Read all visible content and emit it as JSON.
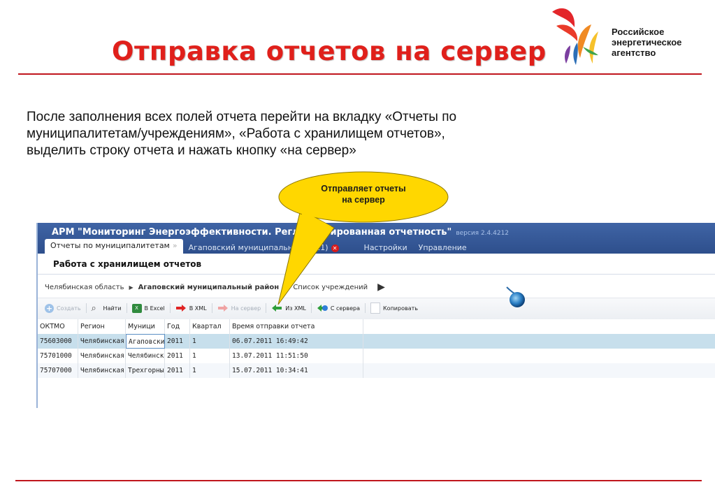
{
  "slide": {
    "title": "Отправка отчетов на сервер",
    "logo_lines": [
      "Российское",
      "энергетическое",
      "агентство"
    ],
    "intro_lines": [
      "После заполнения всех полей отчета перейти на вкладку «Отчеты по",
      "муниципалитетам/учреждениям», «Работа с хранилищем отчетов»,",
      "выделить строку отчета и нажать кнопку «на сервер»"
    ],
    "callout_lines": [
      "Отправляет отчеты",
      "на сервер"
    ]
  },
  "app": {
    "title": "АРМ \"Мониторинг Энергоэффективности. Регламентированная отчетность\"",
    "version": "версия 2.4.4212",
    "tabs": {
      "reports": "Отчеты по муниципалитетам",
      "municipality": "Агаповский муниципальн... (2011)",
      "settings": "Настройки",
      "management": "Управление"
    },
    "section_title": "Работа с хранилищем отчетов",
    "breadcrumb": {
      "region": "Челябинская область",
      "district": "Агаповский муниципальный район",
      "list": "Список учреждений"
    },
    "toolbar": {
      "create": "Создать",
      "find": "Найти",
      "excel": "В Excel",
      "to_xml": "В XML",
      "to_server": "На сервер",
      "from_xml": "Из XML",
      "from_server": "С сервера",
      "copy": "Копировать"
    },
    "table": {
      "headers": [
        "ОКТМО",
        "Регион",
        "Муници",
        "Год",
        "Квартал",
        "Время отправки отчета"
      ],
      "rows": [
        [
          "75603000",
          "Челябинская",
          "Агаповский",
          "2011",
          "1",
          "06.07.2011 16:49:42"
        ],
        [
          "75701000",
          "Челябинская",
          "Челябинск",
          "2011",
          "1",
          "13.07.2011 11:51:50"
        ],
        [
          "75707000",
          "Челябинская",
          "Трехгорный",
          "2011",
          "1",
          "15.07.2011 10:34:41"
        ]
      ],
      "selected_row": 0
    }
  },
  "colors": {
    "title_red": "#e0201b",
    "rule_red": "#c0161d",
    "titlebar_blue": "#345898",
    "selected_row": "#c7dfec",
    "callout_yellow": "#ffd700"
  }
}
